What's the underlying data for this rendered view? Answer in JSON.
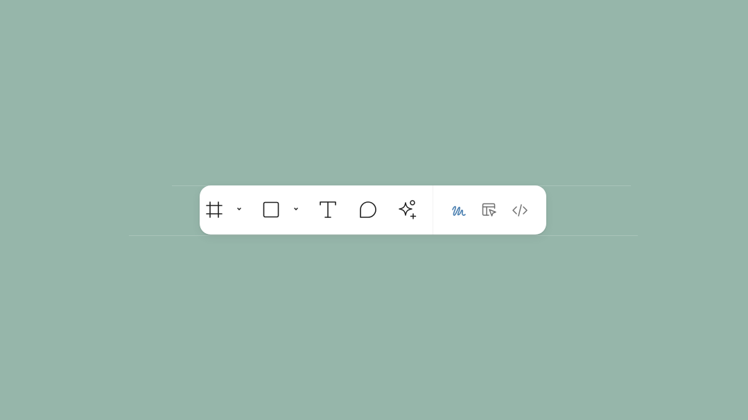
{
  "colors": {
    "canvas_background": "#96b6aa",
    "toolbar_background": "#ffffff",
    "icon_primary": "#1e1e1e",
    "icon_secondary": "#6f6f6f",
    "draw_tool_accent": "#4a7fb0"
  },
  "toolbar": {
    "tools": [
      {
        "id": "frame",
        "icon": "frame-hash-icon",
        "has_dropdown": true
      },
      {
        "id": "shape",
        "icon": "square-icon",
        "has_dropdown": true
      },
      {
        "id": "text",
        "icon": "text-t-icon",
        "has_dropdown": false
      },
      {
        "id": "comment",
        "icon": "speech-bubble-icon",
        "has_dropdown": false
      },
      {
        "id": "ai-actions",
        "icon": "sparkle-plus-icon",
        "has_dropdown": false
      }
    ],
    "mode_toggles": [
      {
        "id": "draw",
        "icon": "scribble-pen-icon",
        "active": true
      },
      {
        "id": "design",
        "icon": "layout-cursor-icon",
        "active": false
      },
      {
        "id": "dev-mode",
        "icon": "code-brackets-icon",
        "active": false
      }
    ]
  }
}
